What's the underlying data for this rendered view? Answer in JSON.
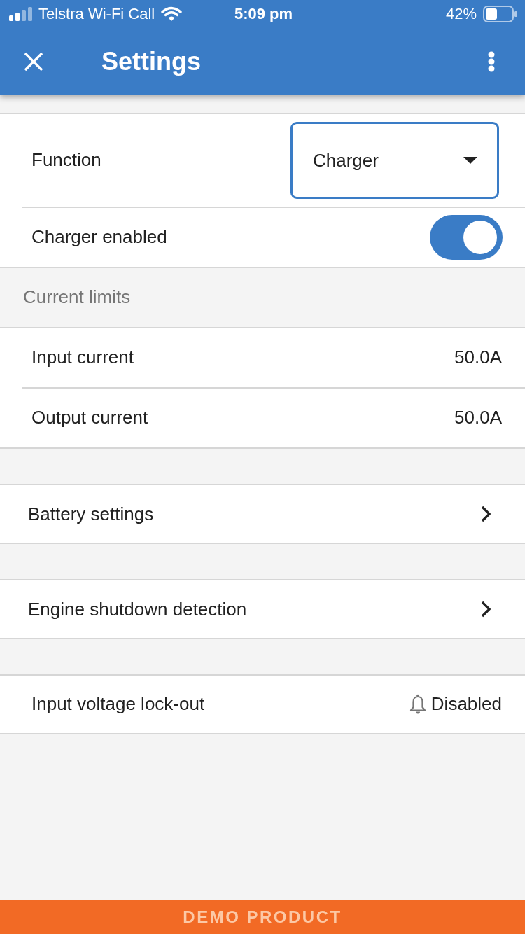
{
  "status_bar": {
    "carrier": "Telstra Wi-Fi Call",
    "time": "5:09 pm",
    "battery": "42%"
  },
  "app_bar": {
    "title": "Settings"
  },
  "groups": [
    {
      "rows": [
        {
          "kind": "dropdown",
          "label": "Function",
          "value": "Charger"
        },
        {
          "kind": "toggle",
          "label": "Charger enabled",
          "on": true
        }
      ]
    },
    {
      "header": "Current limits",
      "rows": [
        {
          "kind": "value",
          "label": "Input current",
          "value": "50.0A"
        },
        {
          "kind": "value",
          "label": "Output current",
          "value": "50.0A"
        }
      ]
    },
    {
      "rows": [
        {
          "kind": "link",
          "label": "Battery settings"
        }
      ]
    },
    {
      "rows": [
        {
          "kind": "link",
          "label": "Engine shutdown detection"
        }
      ]
    },
    {
      "rows": [
        {
          "kind": "alert",
          "label": "Input voltage lock-out",
          "value": "Disabled"
        }
      ]
    }
  ],
  "banner": {
    "text": "DEMO PRODUCT"
  }
}
